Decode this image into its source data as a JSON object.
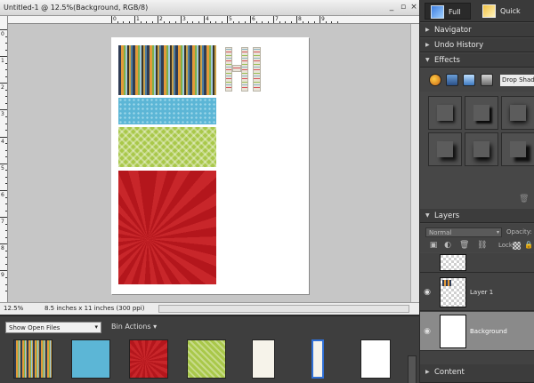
{
  "document": {
    "title": "Untitled-1 @ 12.5%(Background, RGB/8)",
    "minimize_glyph": "_",
    "restore_glyph": "▫",
    "close_glyph": "×",
    "zoom": "12.5%",
    "size_info": "8.5 inches x 11 inches (300 ppi)"
  },
  "rulers": {
    "top_numbers": [
      "0",
      "1",
      "2",
      "3",
      "4",
      "5",
      "6",
      "7",
      "8",
      "9"
    ],
    "left_numbers": [
      "0",
      "1",
      "2",
      "3",
      "4",
      "5",
      "6",
      "7",
      "8",
      "9"
    ]
  },
  "bin": {
    "show_label": "Show Open Files",
    "actions_label": "Bin Actions",
    "dropdown_glyph": "▾"
  },
  "modes": {
    "full": "Full",
    "quick": "Quick"
  },
  "panels": {
    "navigator": "Navigator",
    "undo_history": "Undo History",
    "effects": "Effects",
    "effects_category": "Drop Shadows",
    "layers": "Layers",
    "content": "Content",
    "collapsed_glyph": "▶",
    "expanded_glyph": "▼"
  },
  "layers_panel": {
    "blend_mode": "Normal",
    "opacity_label": "Opacity:",
    "lock_label": "Lock:",
    "layers": [
      {
        "name": "",
        "visible": false
      },
      {
        "name": "Layer 1",
        "visible": true
      },
      {
        "name": "Background",
        "visible": true,
        "selected": true
      }
    ],
    "eye_glyph": "◉"
  },
  "colors": {
    "panel_bg": "#474747",
    "canvas_bg": "#c6c6c6",
    "selection": "#8a8a8a"
  }
}
